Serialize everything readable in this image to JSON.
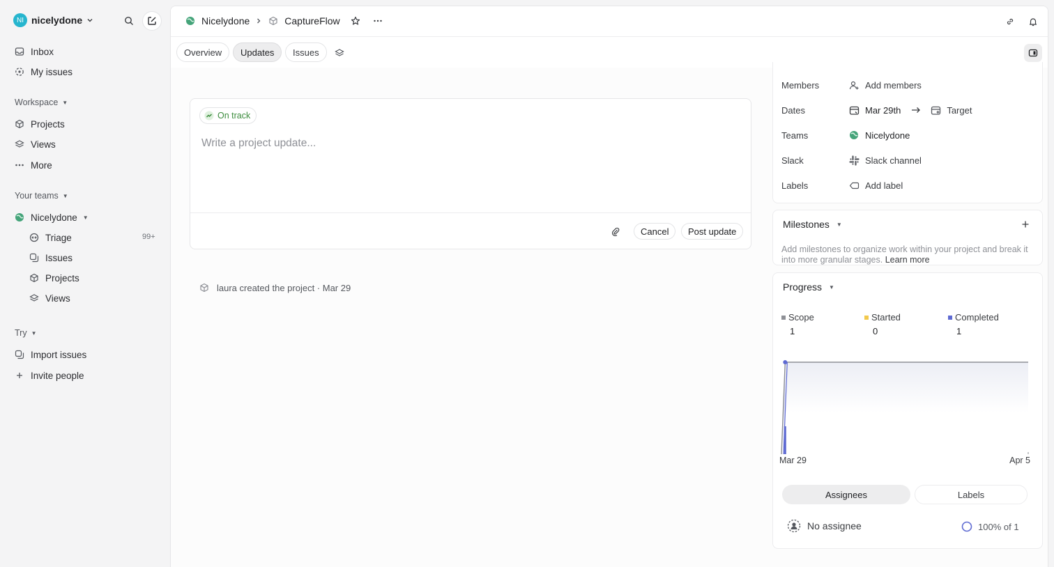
{
  "sidebar": {
    "workspace": {
      "initials": "NI",
      "name": "nicelydone",
      "avatar_color": "#26b5ce"
    },
    "items": {
      "inbox": "Inbox",
      "my_issues": "My issues"
    },
    "workspace_section": {
      "label": "Workspace",
      "projects": "Projects",
      "views": "Views",
      "more": "More"
    },
    "teams_section": {
      "label": "Your teams",
      "team_name": "Nicelydone",
      "triage": "Triage",
      "triage_count": "99+",
      "issues": "Issues",
      "projects": "Projects",
      "views": "Views"
    },
    "try_section": {
      "label": "Try",
      "import": "Import issues",
      "invite": "Invite people"
    }
  },
  "header": {
    "team": "Nicelydone",
    "project": "CaptureFlow"
  },
  "tabs": [
    "Overview",
    "Updates",
    "Issues"
  ],
  "active_tab": "Updates",
  "composer": {
    "status": "On track",
    "status_color": "#3c8c3d",
    "placeholder": "Write a project update...",
    "cancel": "Cancel",
    "post": "Post update"
  },
  "activity": {
    "text": "laura created the project · Mar 29"
  },
  "properties": {
    "members_label": "Members",
    "members_value": "Add members",
    "dates_label": "Dates",
    "start_date": "Mar 29th",
    "target": "Target",
    "teams_label": "Teams",
    "teams_value": "Nicelydone",
    "slack_label": "Slack",
    "slack_value": "Slack channel",
    "labels_label": "Labels",
    "labels_value": "Add label"
  },
  "milestones": {
    "title": "Milestones",
    "text": "Add milestones to organize work within your project and break it into more granular stages.",
    "link": "Learn more"
  },
  "progress": {
    "title": "Progress",
    "scope_label": "Scope",
    "scope_value": "1",
    "started_label": "Started",
    "started_value": "0",
    "completed_label": "Completed",
    "completed_value": "1",
    "colors": {
      "scope": "#8e9096",
      "started": "#f2c94c",
      "completed": "#5e6ad2"
    },
    "segments": [
      "Assignees",
      "Labels"
    ],
    "active_segment": "Assignees",
    "assignee": "No assignee",
    "assignee_progress": "100% of 1"
  },
  "chart_data": {
    "type": "line",
    "x_start": "Mar 29",
    "x_end": "Apr 5",
    "series": [
      {
        "name": "Scope",
        "points": [
          [
            0,
            0
          ],
          [
            1,
            1
          ],
          [
            8,
            1
          ]
        ]
      },
      {
        "name": "Completed",
        "points": [
          [
            0,
            0
          ],
          [
            1,
            1
          ]
        ]
      }
    ],
    "ylim": [
      0,
      1
    ]
  }
}
